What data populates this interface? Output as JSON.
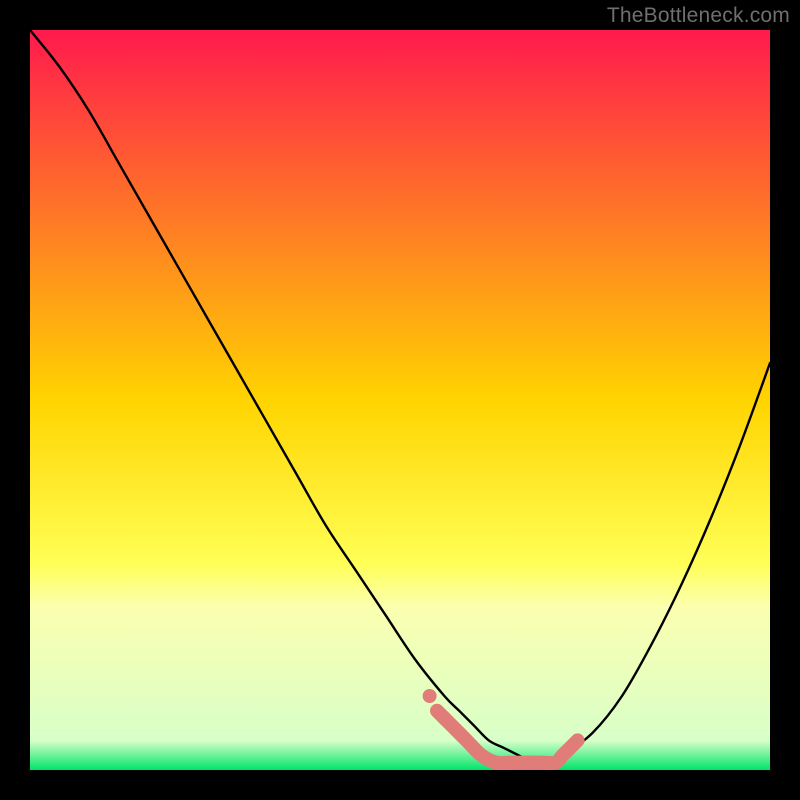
{
  "watermark": {
    "text": "TheBottleneck.com"
  },
  "chart_data": {
    "type": "line",
    "title": "",
    "xlabel": "",
    "ylabel": "",
    "xlim": [
      0,
      100
    ],
    "ylim": [
      0,
      100
    ],
    "grid": false,
    "legend": null,
    "background_gradient_stops": [
      {
        "pos": 0.0,
        "color": "#ff1a4d"
      },
      {
        "pos": 0.5,
        "color": "#ffd400"
      },
      {
        "pos": 0.72,
        "color": "#ffff55"
      },
      {
        "pos": 0.78,
        "color": "#fbffb0"
      },
      {
        "pos": 0.96,
        "color": "#d8ffc8"
      },
      {
        "pos": 1.0,
        "color": "#00e56b"
      }
    ],
    "series": [
      {
        "name": "bottleneck_curve",
        "type": "line",
        "x": [
          0,
          4,
          8,
          12,
          16,
          20,
          24,
          28,
          32,
          36,
          40,
          44,
          48,
          52,
          56,
          58,
          60,
          62,
          64,
          66,
          68,
          70,
          72,
          76,
          80,
          84,
          88,
          92,
          96,
          100
        ],
        "y": [
          100,
          95,
          89,
          82,
          75,
          68,
          61,
          54,
          47,
          40,
          33,
          27,
          21,
          15,
          10,
          8,
          6,
          4,
          3,
          2,
          1,
          1,
          2,
          5,
          10,
          17,
          25,
          34,
          44,
          55
        ]
      },
      {
        "name": "flat_minimum_marker",
        "type": "line",
        "style": "thick-rounded",
        "color": "#e07d78",
        "x": [
          55,
          57,
          59,
          61,
          63,
          65,
          67,
          69,
          71,
          72,
          73,
          74
        ],
        "y": [
          8,
          6,
          4,
          2,
          1,
          1,
          1,
          1,
          1,
          2,
          3,
          4
        ]
      }
    ],
    "annotations": []
  }
}
